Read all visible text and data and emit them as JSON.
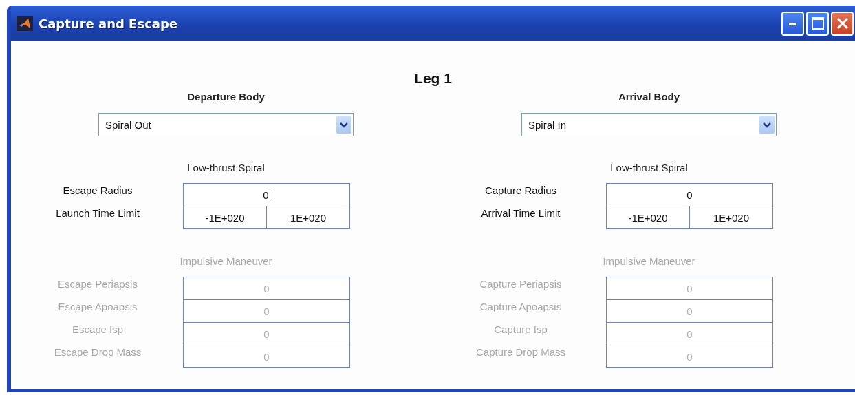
{
  "window": {
    "title": "Capture and Escape"
  },
  "heading": "Leg 1",
  "panels": [
    {
      "title": "Departure Body",
      "dropdown": {
        "value": "Spiral Out"
      },
      "sections": [
        {
          "title": "Low-thrust Spiral",
          "disabled": false,
          "rows": [
            {
              "label": "Escape Radius",
              "fields": [
                {
                  "value": "0",
                  "focused": true
                }
              ]
            },
            {
              "label": "Launch Time Limit",
              "fields": [
                {
                  "value": "-1E+020",
                  "focused": false
                },
                {
                  "value": "1E+020",
                  "focused": false
                }
              ]
            }
          ]
        },
        {
          "title": "Impulsive Maneuver",
          "disabled": true,
          "rows": [
            {
              "label": "Escape Periapsis",
              "fields": [
                {
                  "value": "0",
                  "focused": false
                }
              ]
            },
            {
              "label": "Escape Apoapsis",
              "fields": [
                {
                  "value": "0",
                  "focused": false
                }
              ]
            },
            {
              "label": "Escape Isp",
              "fields": [
                {
                  "value": "0",
                  "focused": false
                }
              ]
            },
            {
              "label": "Escape Drop Mass",
              "fields": [
                {
                  "value": "0",
                  "focused": false
                }
              ]
            }
          ]
        }
      ]
    },
    {
      "title": "Arrival Body",
      "dropdown": {
        "value": "Spiral In"
      },
      "sections": [
        {
          "title": "Low-thrust Spiral",
          "disabled": false,
          "rows": [
            {
              "label": "Capture Radius",
              "fields": [
                {
                  "value": "0",
                  "focused": false
                }
              ]
            },
            {
              "label": "Arrival Time Limit",
              "fields": [
                {
                  "value": "-1E+020",
                  "focused": false
                },
                {
                  "value": "1E+020",
                  "focused": false
                }
              ]
            }
          ]
        },
        {
          "title": "Impulsive Maneuver",
          "disabled": true,
          "rows": [
            {
              "label": "Capture Periapsis",
              "fields": [
                {
                  "value": "0",
                  "focused": false
                }
              ]
            },
            {
              "label": "Capture Apoapsis",
              "fields": [
                {
                  "value": "0",
                  "focused": false
                }
              ]
            },
            {
              "label": "Capture Isp",
              "fields": [
                {
                  "value": "0",
                  "focused": false
                }
              ]
            },
            {
              "label": "Capture Drop Mass",
              "fields": [
                {
                  "value": "0",
                  "focused": false
                }
              ]
            }
          ]
        }
      ]
    }
  ]
}
